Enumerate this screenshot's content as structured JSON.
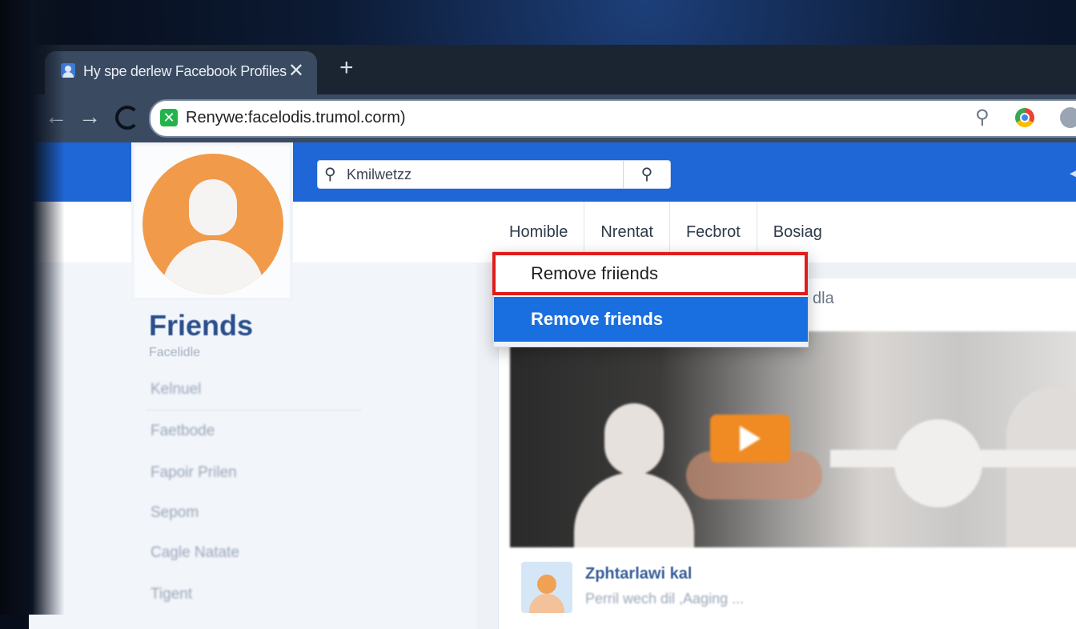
{
  "browser": {
    "tab_title": "Hy spe derlew Facebook Profiles",
    "tab_close": "✕",
    "new_tab": "+",
    "url": "Renywe:facelodis.trumol.corm)",
    "back": "←",
    "forward": "→"
  },
  "header": {
    "search_value": "Kmilwetzz",
    "search_icon": "search-icon"
  },
  "nav": {
    "tabs": [
      "Homible",
      "Nrentat",
      "Fecbrot",
      "Bosiag"
    ]
  },
  "sidebar": {
    "title": "Friends",
    "subtitle": "Facelidle",
    "items": [
      "Kelnuel",
      "Faetbode",
      "Fapoir Prilen",
      "Sepom",
      "Cagle Natate",
      "Tigent"
    ]
  },
  "dropdown": {
    "items": [
      "Remove friiends",
      "Remove friends"
    ]
  },
  "feed": {
    "header_text": "dla",
    "author_name": "Zphtarlawi kal",
    "author_sub": "Perril wech dil ,Aaging ..."
  }
}
